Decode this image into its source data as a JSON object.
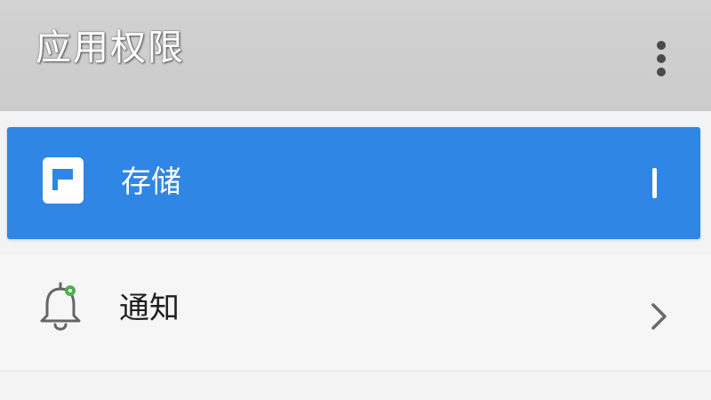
{
  "app_bar": {
    "title": "应用权限",
    "menu_icon": "more-vertical-icon"
  },
  "list": {
    "items": [
      {
        "label": "存储",
        "icon": "storage-icon",
        "selected": true,
        "trailing_icon": "vertical-bar"
      },
      {
        "label": "通知",
        "icon": "bell-icon",
        "selected": false,
        "trailing_icon": "chevron-right-icon"
      }
    ]
  },
  "colors": {
    "app_bar": "#cbcbcb",
    "selected_row": "#2f86e4",
    "text_light": "#ffffff",
    "text_dark": "#202020",
    "notification_dot": "#4caf50"
  }
}
